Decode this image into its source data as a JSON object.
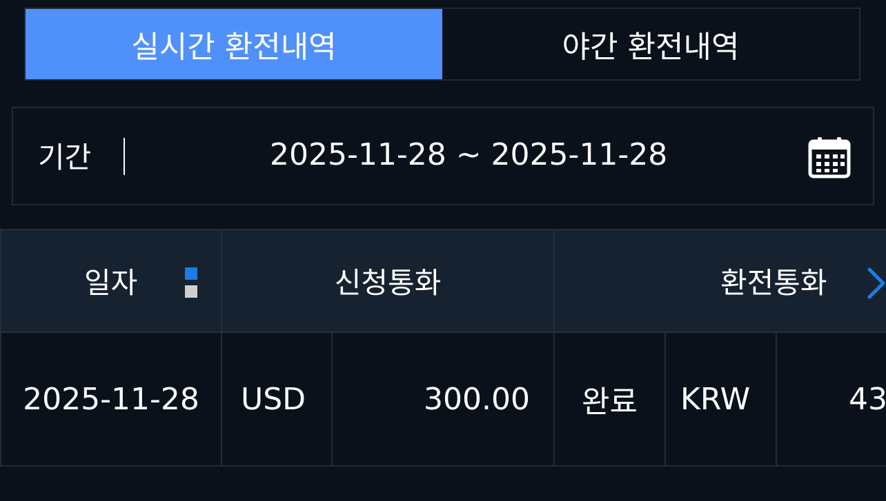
{
  "tabs": {
    "realtime": "실시간 환전내역",
    "night": "야간 환전내역"
  },
  "period": {
    "label": "기간",
    "range": "2025-11-28 ~ 2025-11-28"
  },
  "table": {
    "headers": {
      "date": "일자",
      "request_currency": "신청통화",
      "exchange_currency": "환전통화"
    },
    "rows": [
      {
        "date": "2025-11-28",
        "request_currency": "USD",
        "request_amount": "300.00",
        "status": "완료",
        "exchange_currency": "KRW",
        "exchange_amount": "43"
      }
    ]
  },
  "colors": {
    "accent": "#5090fb",
    "sort_active": "#1a7ee6",
    "background": "#0b111a",
    "header_bg": "#172230"
  },
  "icons": {
    "calendar": "calendar-icon",
    "sort": "sort-icon",
    "more": "chevron-right-icon"
  }
}
